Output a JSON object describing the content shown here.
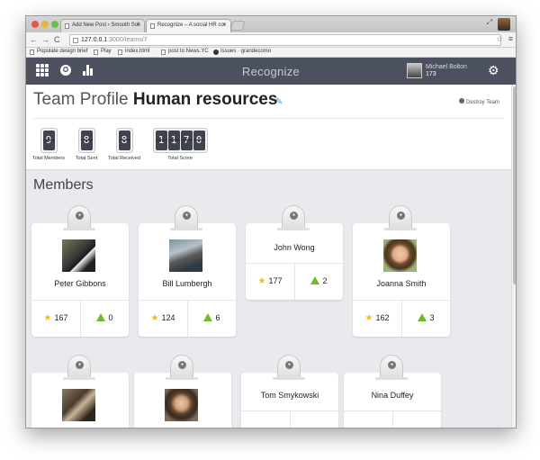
{
  "browser": {
    "tabs": [
      {
        "label": "Add New Post ‹ Smooth Soli"
      },
      {
        "label": "Recognize – A social HR cor"
      }
    ],
    "url_host": "127.0.0.1",
    "url_path": ":3000/teams/7",
    "bookmarks": [
      {
        "label": "Populate design brief"
      },
      {
        "label": "Play"
      },
      {
        "label": "index.html"
      },
      {
        "label": "post to News.YC"
      },
      {
        "label": "Issues · grandecomo"
      }
    ]
  },
  "appbar": {
    "brand": "Recognize",
    "user_name": "Michael Bolton",
    "user_points": "173"
  },
  "profile": {
    "title_prefix": "Team Profile",
    "team_name": "Human resources",
    "destroy_label": "Destroy Team",
    "stats": [
      {
        "label": "Total Members",
        "value": "9"
      },
      {
        "label": "Total Sent",
        "value": "8"
      },
      {
        "label": "Total Received",
        "value": "8"
      },
      {
        "label": "Total Score",
        "value": "1170"
      }
    ]
  },
  "members_title": "Members",
  "members": [
    {
      "name": "Peter Gibbons",
      "stars": "167",
      "received": "0",
      "has_photo": true
    },
    {
      "name": "Bill Lumbergh",
      "stars": "124",
      "received": "6",
      "has_photo": true
    },
    {
      "name": "John Wong",
      "stars": "177",
      "received": "2",
      "has_photo": false
    },
    {
      "name": "Joanna Smith",
      "stars": "162",
      "received": "3",
      "has_photo": true
    },
    {
      "name": "",
      "stars": "",
      "received": "",
      "has_photo": true
    },
    {
      "name": "",
      "stars": "",
      "received": "",
      "has_photo": true
    },
    {
      "name": "Tom Smykowski",
      "stars": "",
      "received": "",
      "has_photo": false
    },
    {
      "name": "Nina Duffey",
      "stars": "",
      "received": "",
      "has_photo": false
    }
  ],
  "colors": {
    "appbar": "#4c5160",
    "star": "#f2b91a",
    "received": "#6abe2a",
    "edit": "#3aa0d8"
  }
}
